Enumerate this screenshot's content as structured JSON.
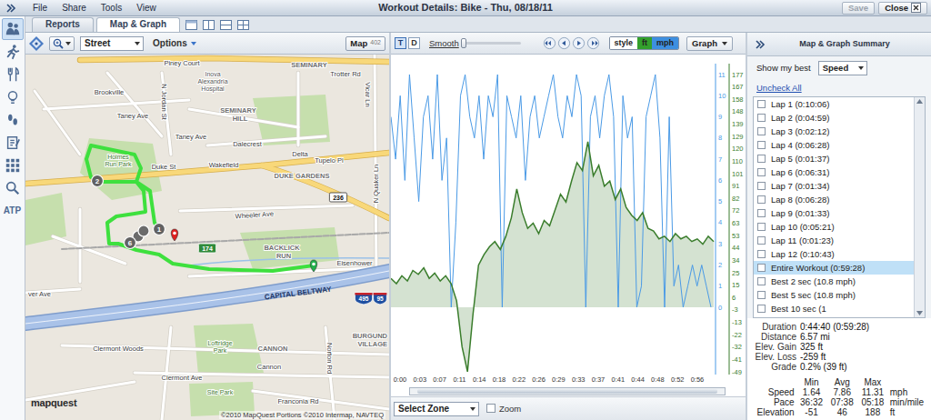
{
  "window": {
    "title": "Workout Details: Bike - Thu, 08/18/11",
    "menu": [
      "File",
      "Share",
      "Tools",
      "View"
    ],
    "save": {
      "label": "Save",
      "disabled": true
    },
    "close": {
      "label": "Close"
    }
  },
  "sidebar": {
    "items": [
      {
        "kind": "icon",
        "selected": true
      },
      {
        "kind": "icon",
        "selected": false
      },
      {
        "kind": "icon",
        "selected": false
      },
      {
        "kind": "icon",
        "selected": false
      },
      {
        "kind": "icon",
        "selected": false
      },
      {
        "kind": "icon",
        "selected": false
      },
      {
        "kind": "icon",
        "selected": false
      },
      {
        "kind": "icon",
        "selected": false
      },
      {
        "kind": "text",
        "label": "ATP",
        "selected": false
      }
    ]
  },
  "tabs": [
    {
      "label": "Reports",
      "selected": false
    },
    {
      "label": "Map & Graph",
      "selected": true
    }
  ],
  "map": {
    "view": "Street",
    "options": "Options",
    "map_button": "Map",
    "map_badge": "402",
    "labels": [
      {
        "text": "Piney Court",
        "kind": "street"
      },
      {
        "text": "SEMINARY",
        "kind": "area"
      },
      {
        "text": "Trotter Rd",
        "kind": "street"
      },
      {
        "text": "Brookville",
        "kind": "street"
      },
      {
        "text": "Inova",
        "kind": "poi"
      },
      {
        "text": "Alexandria",
        "kind": "poi"
      },
      {
        "text": "Hospital",
        "kind": "poi"
      },
      {
        "text": "N Jordan St",
        "kind": "street"
      },
      {
        "text": "SEMINARY",
        "kind": "area"
      },
      {
        "text": "HILL",
        "kind": "area"
      },
      {
        "text": "Taney Ave",
        "kind": "street"
      },
      {
        "text": "Taney Ave",
        "kind": "street"
      },
      {
        "text": "Dalecrest",
        "kind": "street"
      },
      {
        "text": "Holmes",
        "kind": "park"
      },
      {
        "text": "Run Park",
        "kind": "park"
      },
      {
        "text": "Duke St",
        "kind": "street"
      },
      {
        "text": "Wakefield",
        "kind": "street"
      },
      {
        "text": "Delta",
        "kind": "street"
      },
      {
        "text": "Tupelo Pl",
        "kind": "street"
      },
      {
        "text": "DUKE GARDENS",
        "kind": "area"
      },
      {
        "text": "Wheeler Ave",
        "kind": "street"
      },
      {
        "text": "236",
        "kind": "route"
      },
      {
        "text": "BACKLICK",
        "kind": "area"
      },
      {
        "text": "RUN",
        "kind": "area"
      },
      {
        "text": "Eisenhower",
        "kind": "street"
      },
      {
        "text": "174",
        "kind": "state"
      },
      {
        "text": "CAPITAL BELTWAY",
        "kind": "highway"
      },
      {
        "text": "495",
        "kind": "interstate"
      },
      {
        "text": "95",
        "kind": "interstate"
      },
      {
        "text": "Clermont Woods",
        "kind": "street"
      },
      {
        "text": "CANNON",
        "kind": "area"
      },
      {
        "text": "Loftridge",
        "kind": "park"
      },
      {
        "text": "Park",
        "kind": "park"
      },
      {
        "text": "BURGUND",
        "kind": "area"
      },
      {
        "text": "VILLAGE",
        "kind": "area"
      },
      {
        "text": "Clermont Ave",
        "kind": "street"
      },
      {
        "text": "Cannon",
        "kind": "street"
      },
      {
        "text": "Site Park",
        "kind": "park"
      },
      {
        "text": "Norton Rd",
        "kind": "street"
      },
      {
        "text": "Franconia Rd",
        "kind": "street"
      },
      {
        "text": "N Quaker Ln",
        "kind": "street"
      },
      {
        "text": "Vicar Ln",
        "kind": "street"
      },
      {
        "text": "ver Ave",
        "kind": "street"
      }
    ],
    "markers": [
      "2",
      "1",
      "6"
    ],
    "logo": "mapquest",
    "copyright": "©2010 MapQuest  Portions ©2010 Intermap, NAVTEQ"
  },
  "graph_toolbar": {
    "modes": [
      {
        "label": "T",
        "selected": true
      },
      {
        "label": "D",
        "selected": false
      }
    ],
    "smooth": {
      "label": "Smooth",
      "level": 0.05
    },
    "style": {
      "label": "style",
      "units": [
        {
          "label": "ft",
          "color": "#33a02c"
        },
        {
          "label": "mph",
          "color": "#3d8fe0"
        }
      ]
    },
    "graph_button": "Graph"
  },
  "chart": {
    "x_ticks": [
      "0:00",
      "0:03",
      "0:07",
      "0:11",
      "0:14",
      "0:18",
      "0:22",
      "0:26",
      "0:29",
      "0:33",
      "0:37",
      "0:41",
      "0:44",
      "0:48",
      "0:52",
      "0:56"
    ],
    "series": [
      {
        "color": "#4a9ae6",
        "ticks": [
          "11",
          "10",
          "9",
          "8",
          "7",
          "6",
          "5",
          "4",
          "3",
          "2",
          "1",
          "0"
        ],
        "values": [
          9,
          7,
          10,
          6,
          11,
          8,
          5,
          9,
          10,
          7,
          11,
          6,
          8,
          0,
          4,
          10,
          11,
          9,
          8,
          10,
          7,
          10,
          9,
          11,
          0,
          10,
          9,
          8,
          10,
          6,
          9,
          10,
          8,
          9,
          10,
          11,
          9,
          8,
          10,
          9,
          11,
          10,
          0,
          9,
          10,
          8,
          10,
          11,
          9,
          0,
          10,
          8,
          9,
          0,
          1,
          9,
          10,
          11,
          8,
          0,
          9,
          1,
          2,
          0,
          1,
          2,
          1,
          2,
          1,
          0
        ]
      },
      {
        "color": "#3a7d2c",
        "ticks": [
          "177",
          "167",
          "158",
          "148",
          "139",
          "129",
          "120",
          "110",
          "101",
          "91",
          "82",
          "72",
          "63",
          "53",
          "44",
          "34",
          "25",
          "15",
          "6",
          "-3",
          "-13",
          "-22",
          "-32",
          "-41",
          "-49"
        ],
        "values": [
          22,
          18,
          24,
          20,
          28,
          25,
          30,
          22,
          26,
          20,
          24,
          18,
          5,
          -30,
          -49,
          -5,
          32,
          40,
          46,
          50,
          44,
          54,
          68,
          90,
          72,
          60,
          64,
          56,
          66,
          62,
          74,
          86,
          80,
          96,
          110,
          104,
          126,
          100,
          108,
          92,
          96,
          82,
          90,
          76,
          70,
          66,
          72,
          60,
          58,
          52,
          54,
          50,
          56,
          52,
          54,
          50,
          52,
          48,
          54,
          50
        ]
      }
    ]
  },
  "zone": {
    "label": "Select Zone"
  },
  "zoom": {
    "label": "Zoom",
    "checked": false
  },
  "summary": {
    "title": "Map & Graph Summary",
    "show_best": {
      "label": "Show my best",
      "value": "Speed"
    },
    "uncheck_all": "Uncheck All",
    "items": [
      {
        "label": "Lap 1 (0:10:06)",
        "checked": false,
        "selected": false
      },
      {
        "label": "Lap 2 (0:04:59)",
        "checked": false,
        "selected": false
      },
      {
        "label": "Lap 3 (0:02:12)",
        "checked": false,
        "selected": false
      },
      {
        "label": "Lap 4 (0:06:28)",
        "checked": false,
        "selected": false
      },
      {
        "label": "Lap 5 (0:01:37)",
        "checked": false,
        "selected": false
      },
      {
        "label": "Lap 6 (0:06:31)",
        "checked": false,
        "selected": false
      },
      {
        "label": "Lap 7 (0:01:34)",
        "checked": false,
        "selected": false
      },
      {
        "label": "Lap 8 (0:06:28)",
        "checked": false,
        "selected": false
      },
      {
        "label": "Lap 9 (0:01:33)",
        "checked": false,
        "selected": false
      },
      {
        "label": "Lap 10 (0:05:21)",
        "checked": false,
        "selected": false
      },
      {
        "label": "Lap 11 (0:01:23)",
        "checked": false,
        "selected": false
      },
      {
        "label": "Lap 12 (0:10:43)",
        "checked": false,
        "selected": false
      },
      {
        "label": "Entire Workout (0:59:28)",
        "checked": false,
        "selected": true
      },
      {
        "label": "Best 2 sec (10.8 mph)",
        "checked": false,
        "selected": false
      },
      {
        "label": "Best 5 sec (10.8 mph)",
        "checked": false,
        "selected": false
      },
      {
        "label": "Best 10 sec (1",
        "checked": false,
        "selected": false
      }
    ],
    "stats": [
      {
        "label": "Duration",
        "value": "0:44:40 (0:59:28)"
      },
      {
        "label": "Distance",
        "value": "6.57 mi"
      },
      {
        "label": "Elev. Gain",
        "value": "325 ft"
      },
      {
        "label": "Elev. Loss",
        "value": "-259 ft"
      },
      {
        "label": "Grade",
        "value": "0.2% (39 ft)"
      }
    ],
    "table": {
      "columns": [
        "Min",
        "Avg",
        "Max"
      ],
      "rows": [
        {
          "label": "Speed",
          "cells": [
            "1.64",
            "7.86",
            "11.31"
          ],
          "unit": "mph"
        },
        {
          "label": "Pace",
          "cells": [
            "36:32",
            "07:38",
            "05:18"
          ],
          "unit": "min/mile"
        },
        {
          "label": "Elevation",
          "cells": [
            "-51",
            "46",
            "188"
          ],
          "unit": "ft"
        }
      ]
    }
  }
}
